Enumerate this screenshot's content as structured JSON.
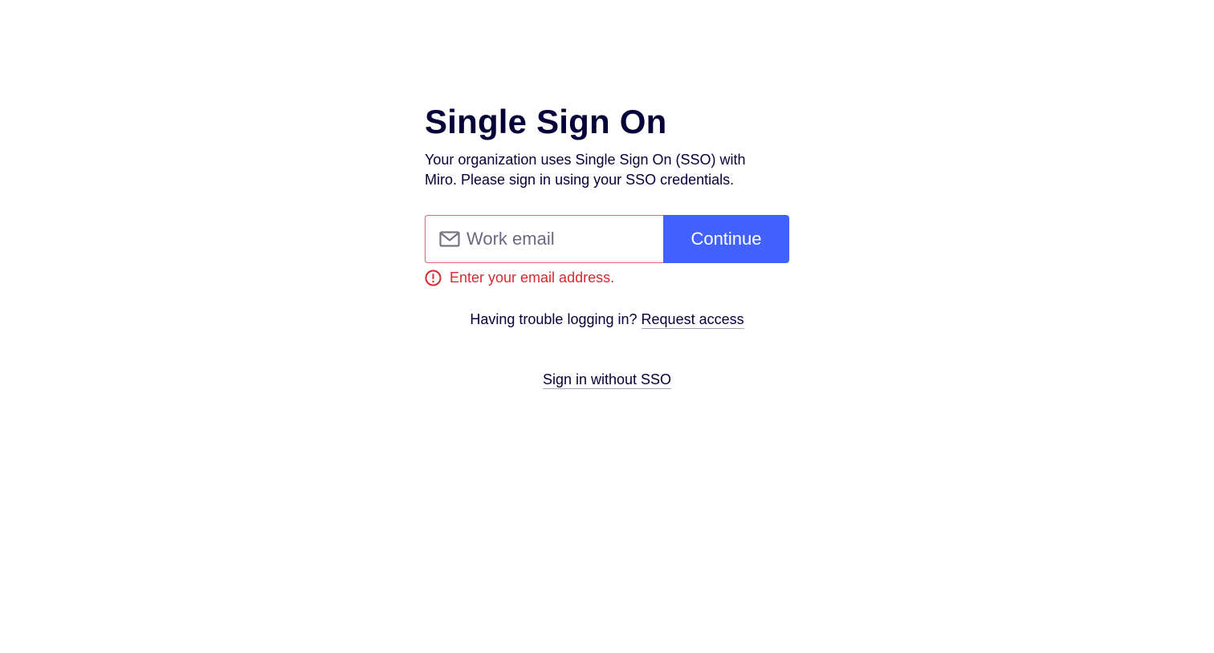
{
  "page": {
    "title": "Single Sign On",
    "subtitle": "Your organization uses Single Sign On (SSO) with Miro. Please sign in using your SSO credentials."
  },
  "form": {
    "email_placeholder": "Work email",
    "email_value": "",
    "email_icon": "envelope-icon",
    "continue_label": "Continue",
    "error_icon": "alert-circle-icon",
    "error_message": "Enter your email address."
  },
  "help": {
    "trouble_text": "Having trouble logging in?",
    "request_access_label": "Request access",
    "sign_in_without_sso_label": "Sign in without SSO"
  },
  "colors": {
    "primary": "#4262ff",
    "text": "#050038",
    "error": "#d9282f",
    "error_border": "#e0666f"
  }
}
